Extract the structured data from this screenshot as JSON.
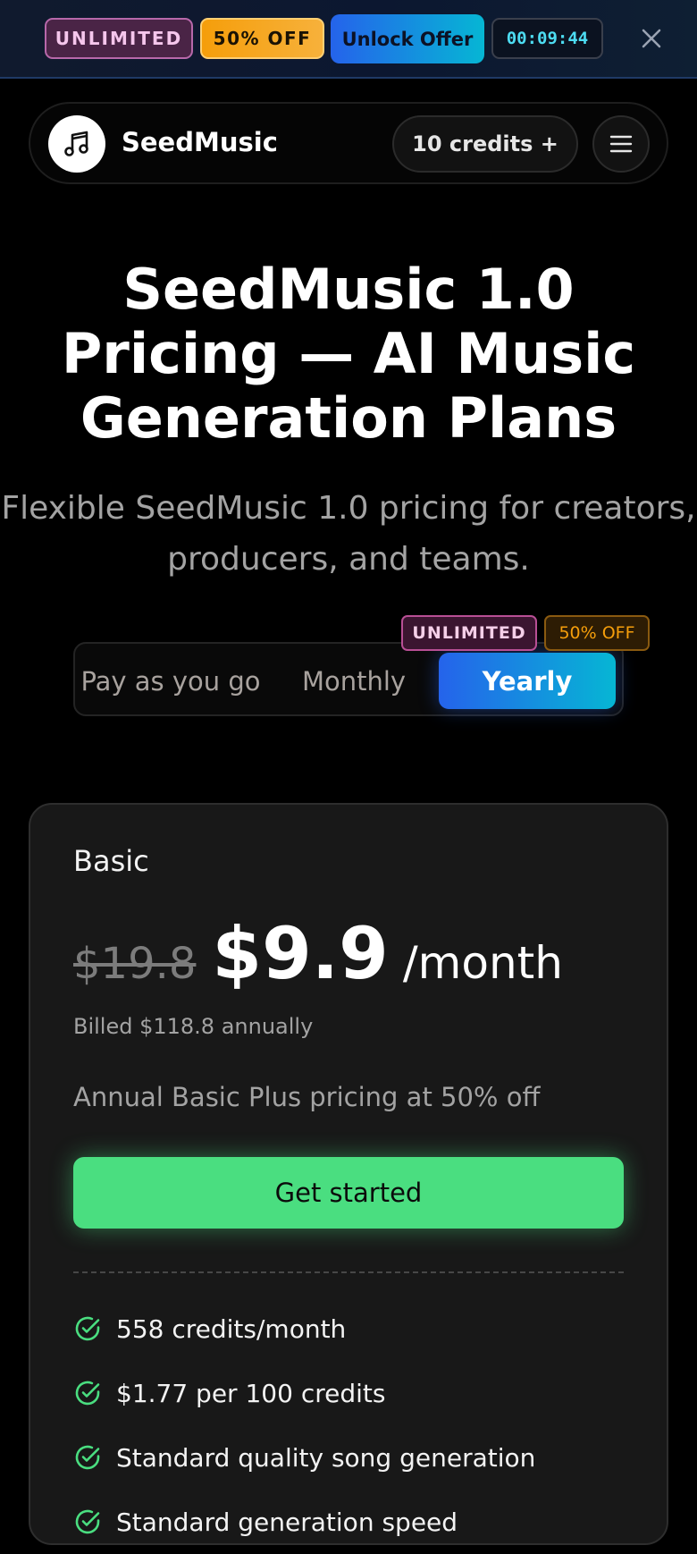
{
  "promo": {
    "badge_unlimited": "UNLIMITED",
    "badge_discount": "50% OFF",
    "cta_label": "Unlock Offer",
    "countdown": "00:09:44",
    "close_icon": "close-icon"
  },
  "header": {
    "logo_icon": "music-note-icon",
    "brand": "SeedMusic",
    "credits_label": "10 credits +",
    "menu_icon": "hamburger-menu-icon"
  },
  "hero": {
    "title": "SeedMusic 1.0 Pricing — AI Music Generation Plans",
    "subtitle": "Flexible SeedMusic 1.0 pricing for creators, producers, and teams."
  },
  "billing": {
    "options": [
      "Pay as you go",
      "Monthly",
      "Yearly"
    ],
    "selected": "Yearly",
    "badge_unlimited": "UNLIMITED",
    "badge_discount": "50% OFF"
  },
  "plan": {
    "name": "Basic",
    "price_original": "$19.8",
    "price": "$9.9",
    "period": "/month",
    "billed": "Billed $118.8 annually",
    "description": "Annual Basic Plus pricing at 50% off",
    "cta_label": "Get started",
    "features": [
      "558 credits/month",
      "$1.77 per 100 credits",
      "Standard quality song generation",
      "Standard generation speed"
    ]
  },
  "colors": {
    "accent_green": "#4ade80",
    "accent_blue": "#2563eb",
    "accent_cyan": "#06b6d4",
    "accent_orange": "#f59e0b",
    "accent_pink": "#b768aa"
  }
}
